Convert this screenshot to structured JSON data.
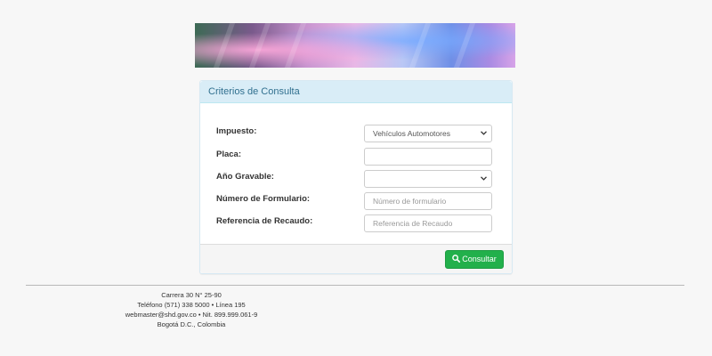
{
  "panel": {
    "title": "Criterios de Consulta"
  },
  "form": {
    "impuesto": {
      "label": "Impuesto:",
      "value": "Vehículos Automotores"
    },
    "placa": {
      "label": "Placa:",
      "value": ""
    },
    "anio": {
      "label": "Año Gravable:",
      "value": ""
    },
    "formulario": {
      "label": "Número de Formulario:",
      "placeholder": "Número de formulario"
    },
    "referencia": {
      "label": "Referencia de Recaudo:",
      "placeholder": "Referencia de Recaudo"
    }
  },
  "actions": {
    "consultar_label": "Consultar"
  },
  "footer": {
    "address": "Carrera 30 N° 25-90",
    "phone": "Teléfono (571) 338 5000 • Línea 195",
    "contact": "webmaster@shd.gov.co • Nit. 899.999.061-9",
    "city": "Bogotá D.C., Colombia"
  },
  "colors": {
    "heading_bg": "#d9edf7",
    "heading_text": "#31708f",
    "button_bg": "#22b04b"
  },
  "icons": {
    "select_caret": "chevron-down-icon",
    "button_icon": "search-icon"
  }
}
